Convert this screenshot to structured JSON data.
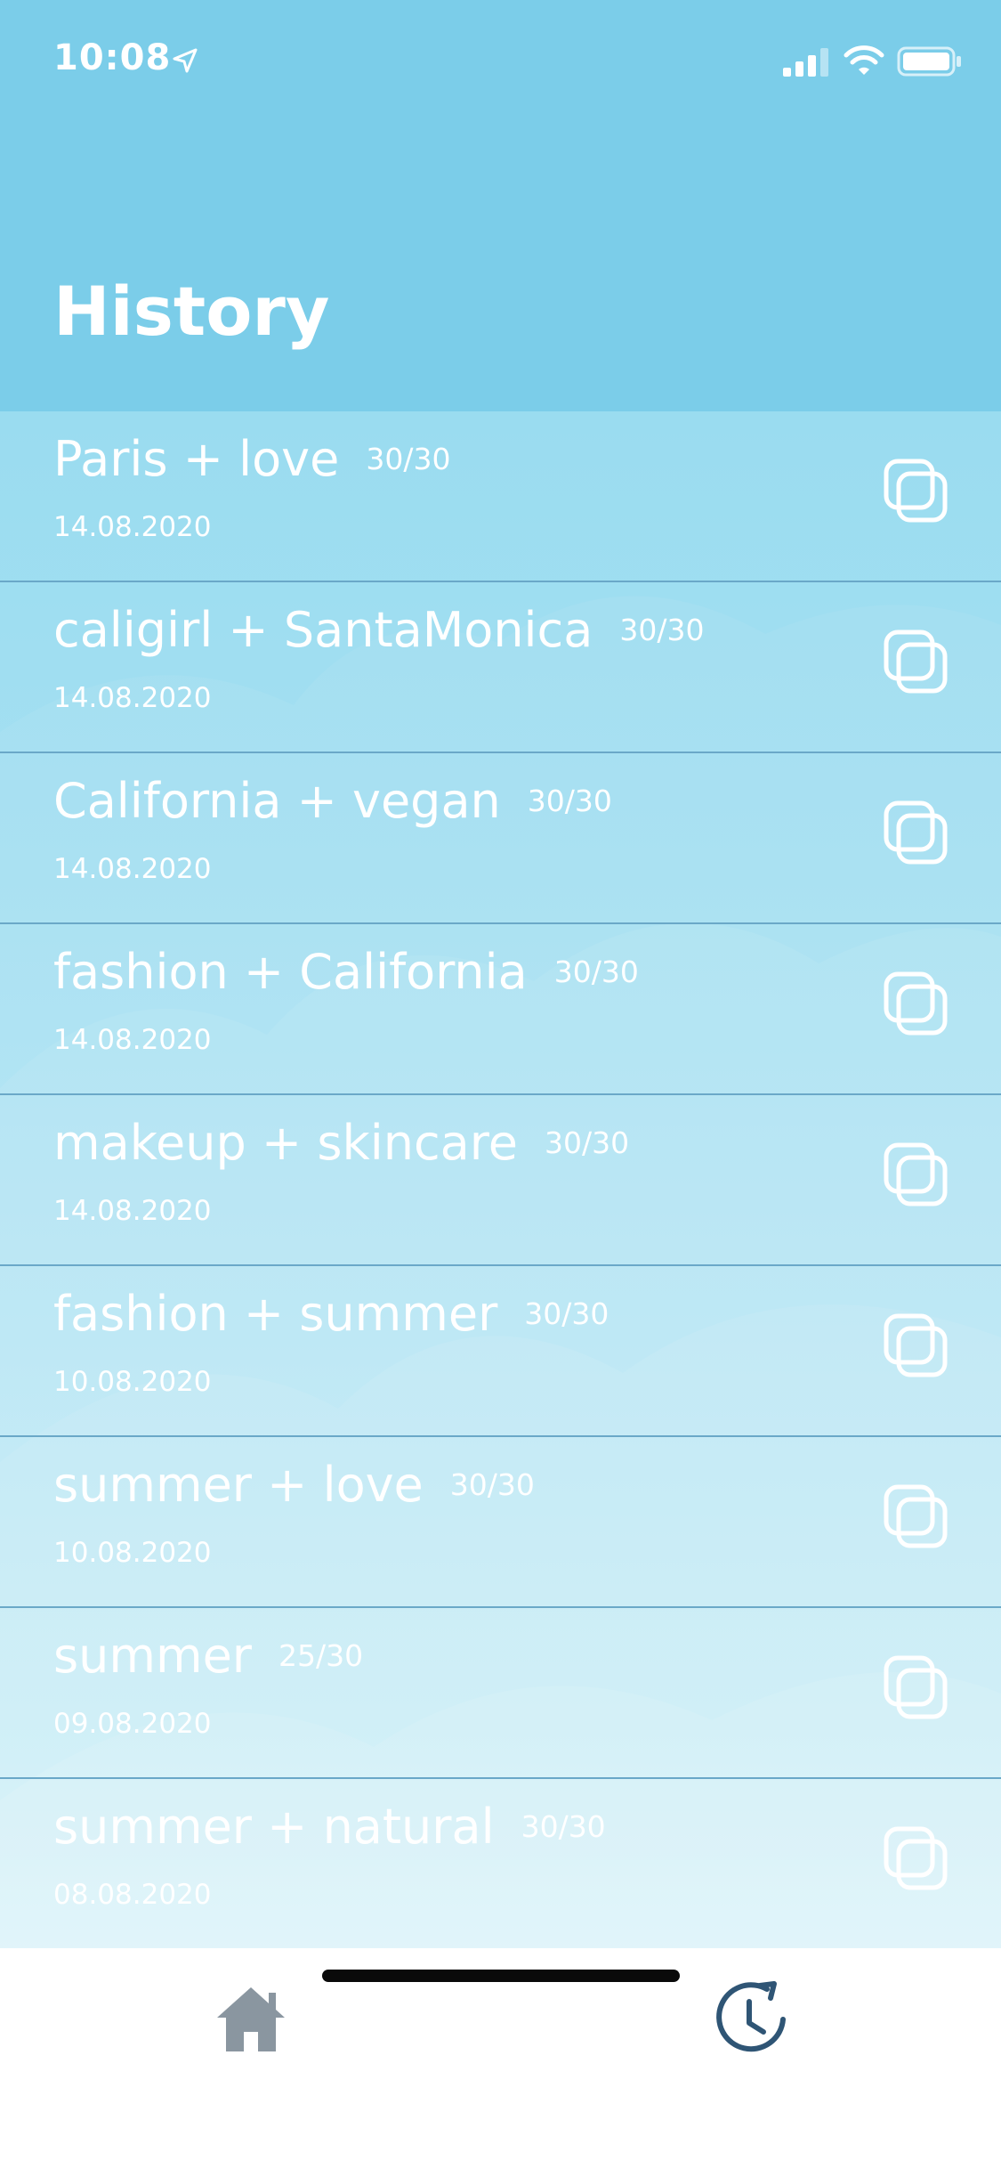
{
  "status_bar": {
    "time": "10:08"
  },
  "header": {
    "title": "History"
  },
  "history": [
    {
      "title": "Paris + love",
      "count": "30/30",
      "date": "14.08.2020"
    },
    {
      "title": "caligirl + SantaMonica",
      "count": "30/30",
      "date": "14.08.2020"
    },
    {
      "title": "California + vegan",
      "count": "30/30",
      "date": "14.08.2020"
    },
    {
      "title": "fashion + California",
      "count": "30/30",
      "date": "14.08.2020"
    },
    {
      "title": "makeup + skincare",
      "count": "30/30",
      "date": "14.08.2020"
    },
    {
      "title": "fashion + summer",
      "count": "30/30",
      "date": "10.08.2020"
    },
    {
      "title": "summer + love",
      "count": "30/30",
      "date": "10.08.2020"
    },
    {
      "title": "summer",
      "count": "25/30",
      "date": "09.08.2020"
    },
    {
      "title": "summer + natural",
      "count": "30/30",
      "date": "08.08.2020"
    }
  ],
  "tab_bar": {
    "tabs": [
      {
        "icon": "home-icon",
        "active": false
      },
      {
        "icon": "history-icon",
        "active": true
      }
    ]
  },
  "colors": {
    "header_bg": "#7bcde9",
    "list_bg_top": "#9adcf0",
    "list_bg_bottom": "#d8f2fa",
    "divider": "#6aa8c8",
    "text": "#ffffff",
    "tab_home": "#8a96a0",
    "tab_history": "#2f5575"
  }
}
